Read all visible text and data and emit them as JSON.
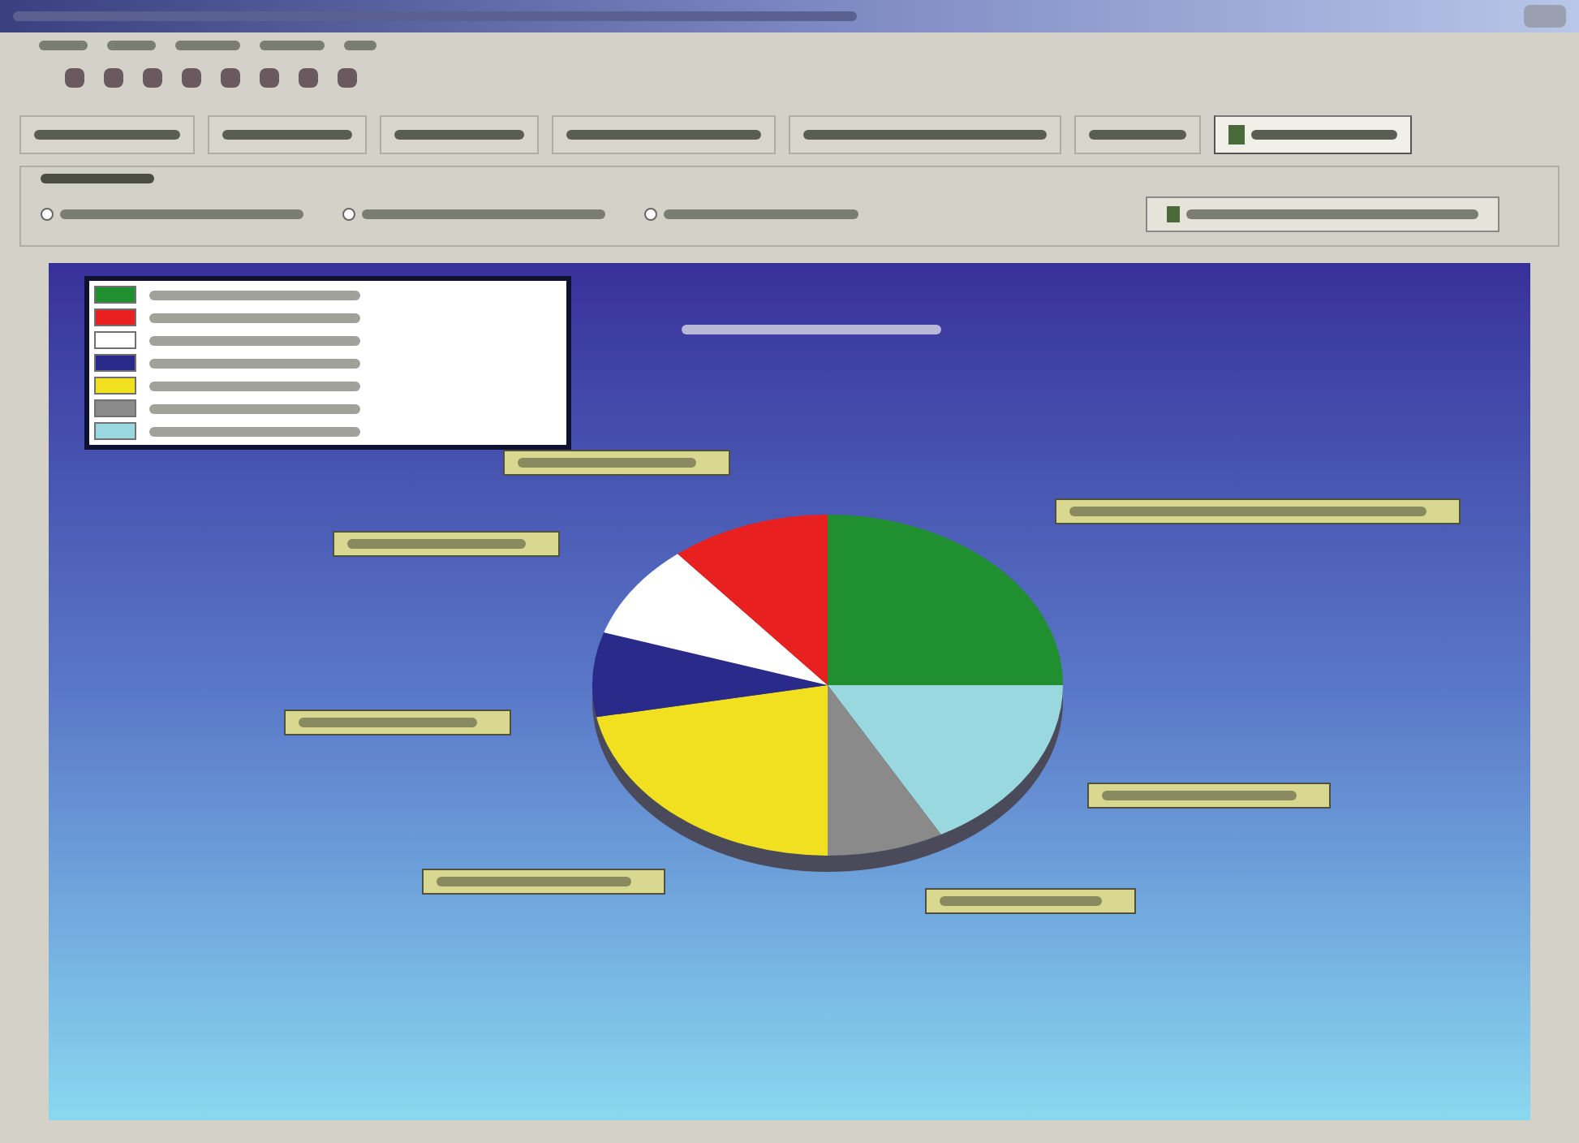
{
  "tabs": [
    {
      "selected": false
    },
    {
      "selected": false
    },
    {
      "selected": false
    },
    {
      "selected": false
    },
    {
      "selected": false
    },
    {
      "selected": false
    },
    {
      "selected": true
    }
  ],
  "options": [
    {
      "selected": false
    },
    {
      "selected": false
    },
    {
      "selected": false
    }
  ],
  "legend": [
    {
      "color": "#1f8f2f"
    },
    {
      "color": "#e82020"
    },
    {
      "color": "#ffffff"
    },
    {
      "color": "#2a2a8a"
    },
    {
      "color": "#f0e020"
    },
    {
      "color": "#8a8a8a"
    },
    {
      "color": "#9ad8e0"
    }
  ]
}
